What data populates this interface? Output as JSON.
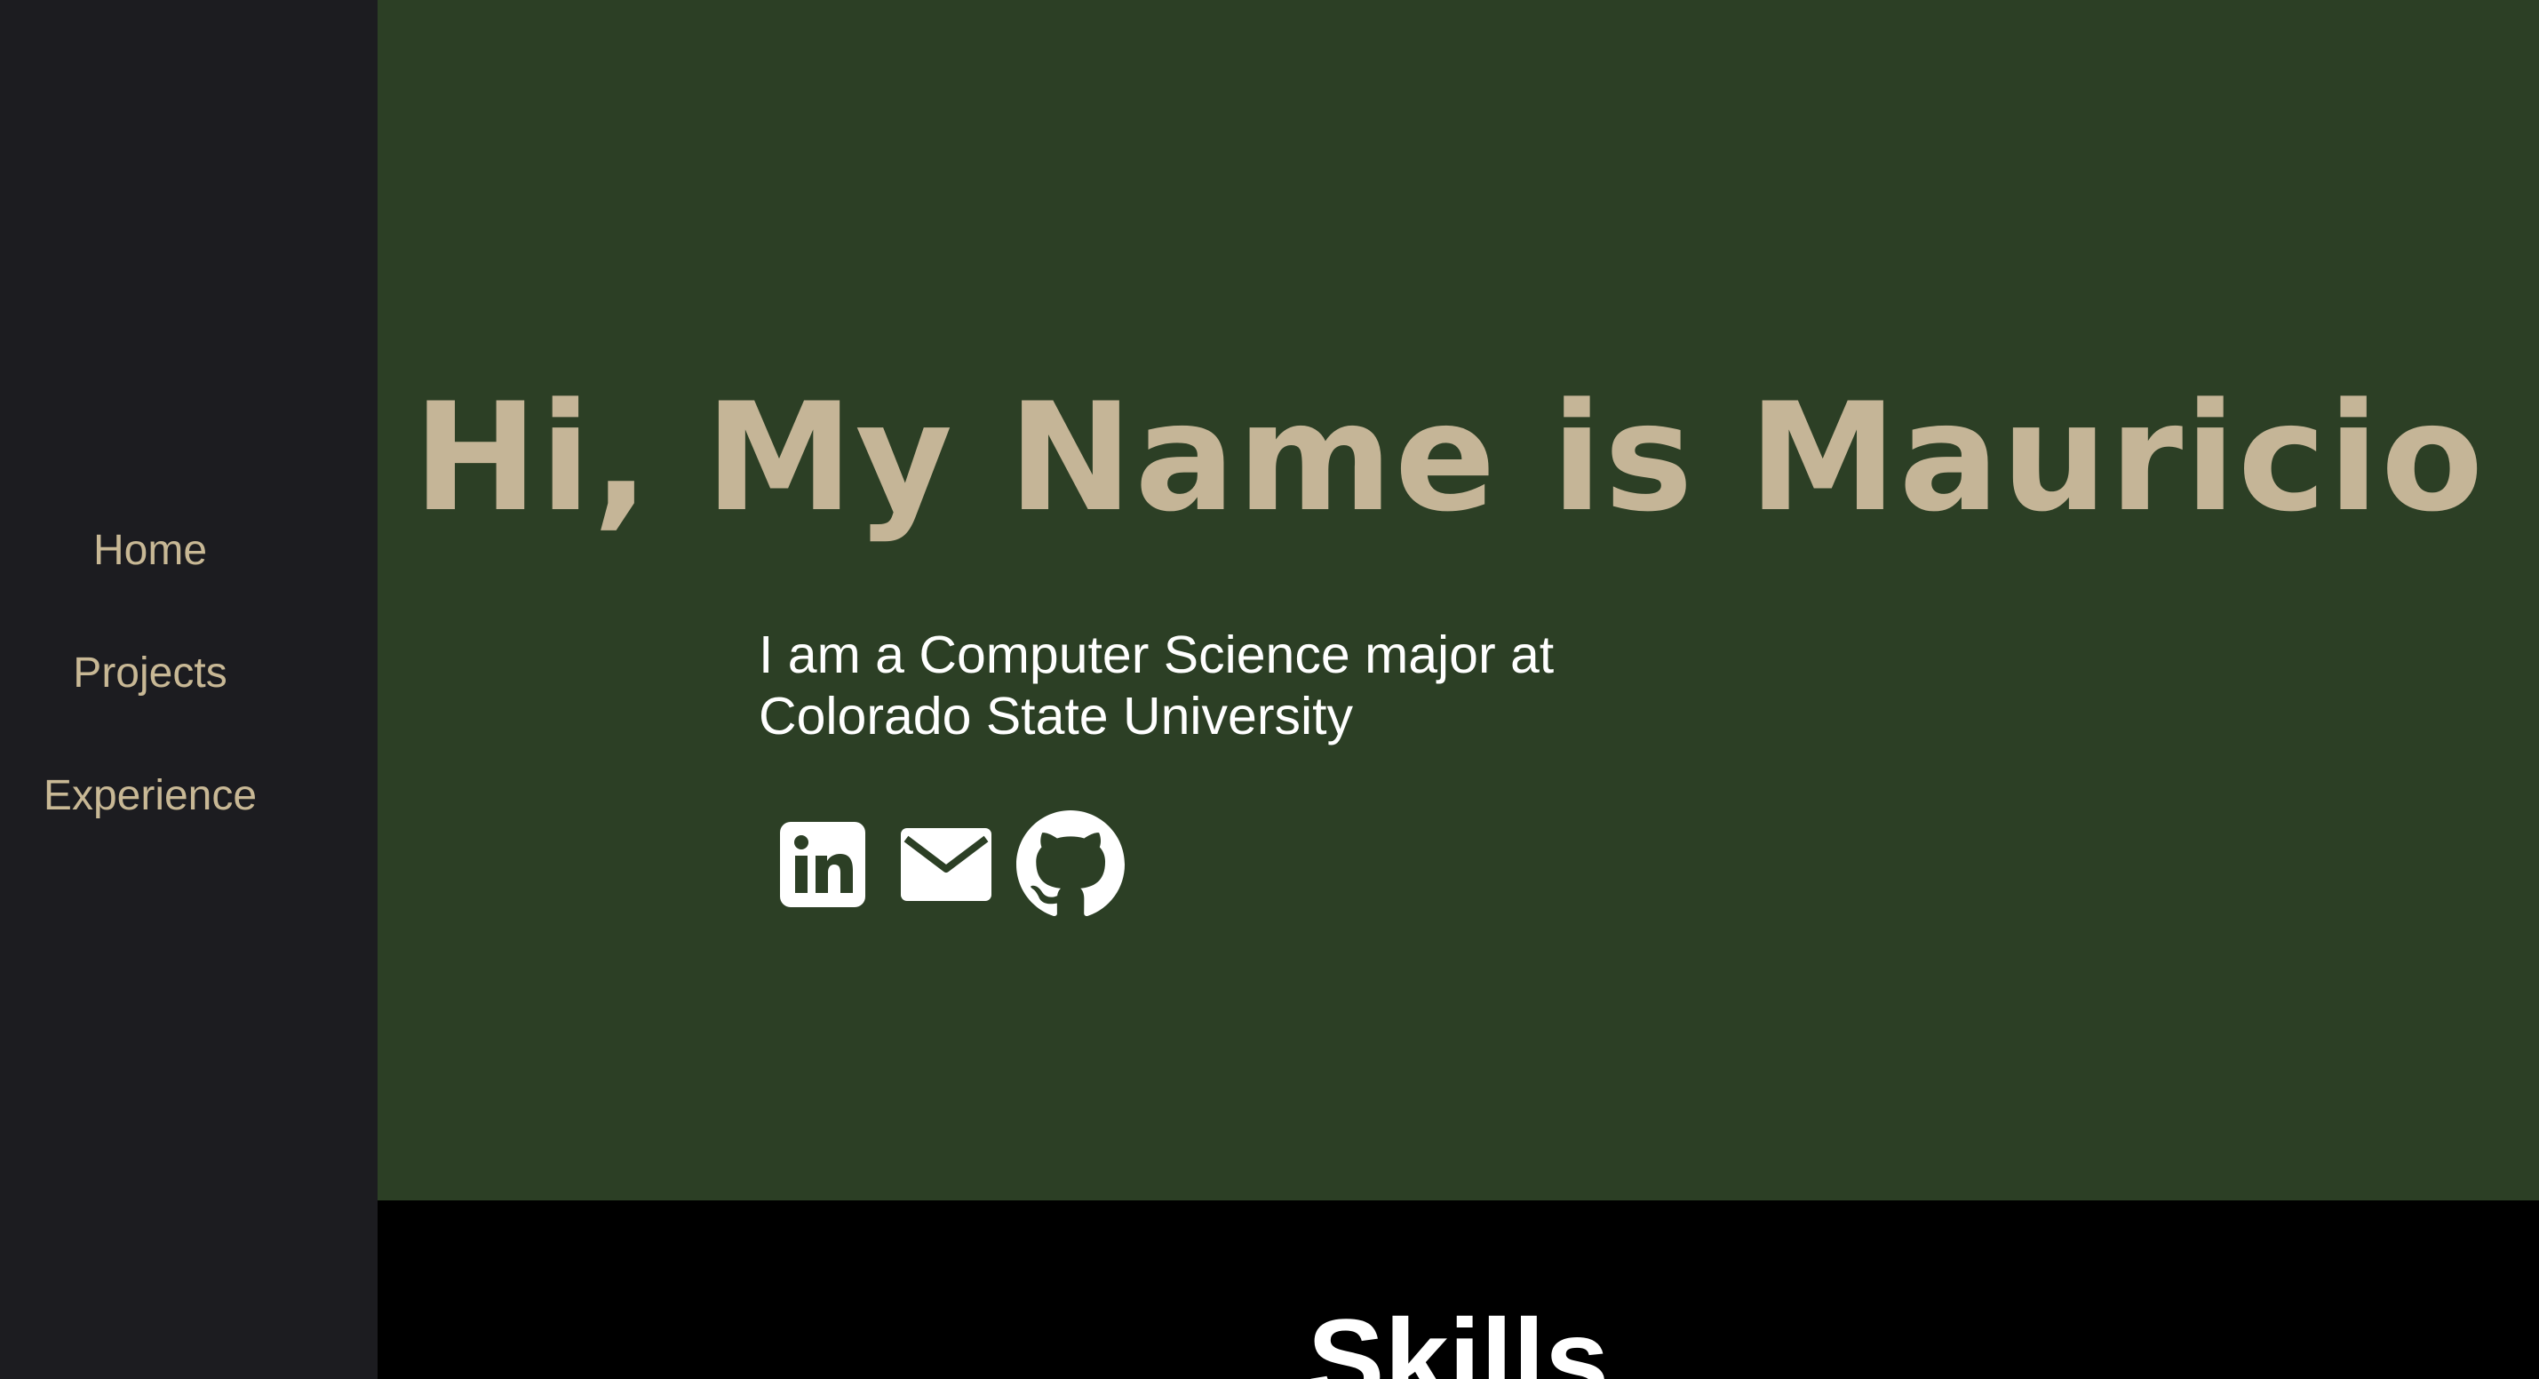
{
  "sidebar": {
    "items": [
      {
        "label": "Home"
      },
      {
        "label": "Projects"
      },
      {
        "label": "Experience"
      }
    ]
  },
  "hero": {
    "title": "Hi, My Name is Mauricio",
    "intro": "I am a Computer Science major at Colorado State University",
    "socials": [
      {
        "icon": "linkedin-icon"
      },
      {
        "icon": "email-icon"
      },
      {
        "icon": "github-icon"
      }
    ]
  },
  "skills": {
    "title": "Skills"
  },
  "colors": {
    "sidebar_bg": "#1c1c20",
    "hero_bg": "#2c3f25",
    "accent_tan": "#c5b597",
    "text_white": "#ffffff",
    "skills_bg": "#000000"
  }
}
